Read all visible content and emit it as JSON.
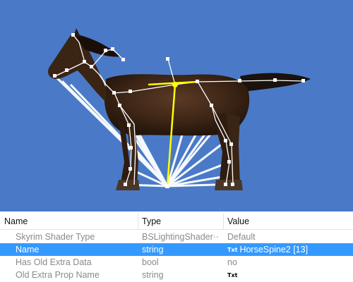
{
  "viewport": {
    "background_color": "#4a7ac7",
    "model": "horse",
    "selected_bone_color": "#ffff00",
    "bone_color": "#ffffff"
  },
  "properties": {
    "columns": {
      "name": "Name",
      "type": "Type",
      "value": "Value"
    },
    "rows": [
      {
        "name": "Skyrim Shader Type",
        "type": "BSLightingShader···",
        "value": "Default",
        "value_icon": "",
        "state": "dim"
      },
      {
        "name": "Name",
        "type": "string",
        "value": "HorseSpine2 [13]",
        "value_icon": "Txt",
        "state": "selected"
      },
      {
        "name": "Has Old Extra Data",
        "type": "bool",
        "value": "no",
        "value_icon": "",
        "state": "dim"
      },
      {
        "name": "Old Extra Prop Name",
        "type": "string",
        "value": "",
        "value_icon": "Txt",
        "state": "dim"
      }
    ]
  }
}
